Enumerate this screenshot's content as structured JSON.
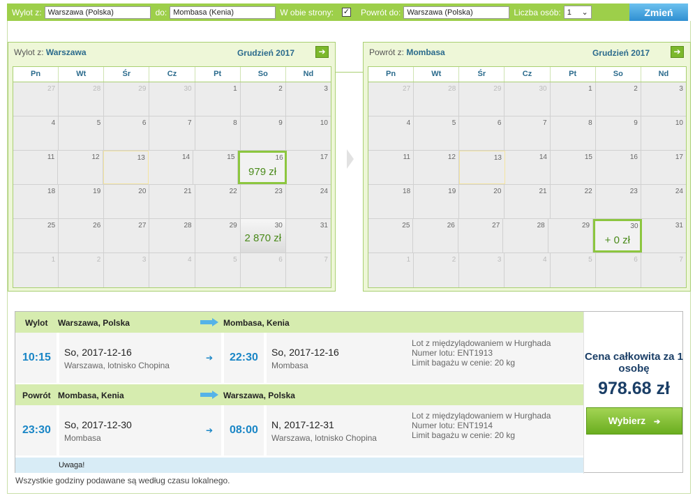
{
  "search": {
    "from_label": "Wylot z:",
    "from_value": "Warszawa (Polska)",
    "to_label": "do:",
    "to_value": "Mombasa (Kenia)",
    "both_ways_label": "W obie strony:",
    "both_ways_check": "✓",
    "return_label": "Powrót do:",
    "return_value": "Warszawa (Polska)",
    "persons_label": "Liczba osób:",
    "persons_value": "1",
    "change_button": "Zmień"
  },
  "calendars": [
    {
      "title_prefix": "Wylot z:",
      "title_city": "Warszawa",
      "month": "Grudzień 2017",
      "days_of_week": [
        "Pn",
        "Wt",
        "Śr",
        "Cz",
        "Pt",
        "So",
        "Nd"
      ],
      "weeks": [
        [
          {
            "d": "27",
            "out": true
          },
          {
            "d": "28",
            "out": true
          },
          {
            "d": "29",
            "out": true
          },
          {
            "d": "30",
            "out": true
          },
          {
            "d": "1"
          },
          {
            "d": "2"
          },
          {
            "d": "3"
          }
        ],
        [
          {
            "d": "4"
          },
          {
            "d": "5"
          },
          {
            "d": "6"
          },
          {
            "d": "7"
          },
          {
            "d": "8"
          },
          {
            "d": "9"
          },
          {
            "d": "10"
          }
        ],
        [
          {
            "d": "11"
          },
          {
            "d": "12"
          },
          {
            "d": "13",
            "hl": true
          },
          {
            "d": "14"
          },
          {
            "d": "15"
          },
          {
            "d": "16",
            "price": "979 zł",
            "sel": true
          },
          {
            "d": "17"
          }
        ],
        [
          {
            "d": "18"
          },
          {
            "d": "19"
          },
          {
            "d": "20"
          },
          {
            "d": "21"
          },
          {
            "d": "22"
          },
          {
            "d": "23"
          },
          {
            "d": "24"
          }
        ],
        [
          {
            "d": "25"
          },
          {
            "d": "26"
          },
          {
            "d": "27"
          },
          {
            "d": "28"
          },
          {
            "d": "29"
          },
          {
            "d": "30",
            "price": "2 870 zł",
            "grad": true
          },
          {
            "d": "31"
          }
        ],
        [
          {
            "d": "1",
            "out": true
          },
          {
            "d": "2",
            "out": true
          },
          {
            "d": "3",
            "out": true
          },
          {
            "d": "4",
            "out": true
          },
          {
            "d": "5",
            "out": true
          },
          {
            "d": "6",
            "out": true
          },
          {
            "d": "7",
            "out": true
          }
        ]
      ]
    },
    {
      "title_prefix": "Powrót z:",
      "title_city": "Mombasa",
      "month": "Grudzień 2017",
      "days_of_week": [
        "Pn",
        "Wt",
        "Śr",
        "Cz",
        "Pt",
        "So",
        "Nd"
      ],
      "weeks": [
        [
          {
            "d": "27",
            "out": true
          },
          {
            "d": "28",
            "out": true
          },
          {
            "d": "29",
            "out": true
          },
          {
            "d": "30",
            "out": true
          },
          {
            "d": "1"
          },
          {
            "d": "2"
          },
          {
            "d": "3"
          }
        ],
        [
          {
            "d": "4"
          },
          {
            "d": "5"
          },
          {
            "d": "6"
          },
          {
            "d": "7"
          },
          {
            "d": "8"
          },
          {
            "d": "9"
          },
          {
            "d": "10"
          }
        ],
        [
          {
            "d": "11"
          },
          {
            "d": "12"
          },
          {
            "d": "13",
            "hl": true
          },
          {
            "d": "14"
          },
          {
            "d": "15"
          },
          {
            "d": "16"
          },
          {
            "d": "17"
          }
        ],
        [
          {
            "d": "18"
          },
          {
            "d": "19"
          },
          {
            "d": "20"
          },
          {
            "d": "21"
          },
          {
            "d": "22"
          },
          {
            "d": "23"
          },
          {
            "d": "24"
          }
        ],
        [
          {
            "d": "25"
          },
          {
            "d": "26"
          },
          {
            "d": "27"
          },
          {
            "d": "28"
          },
          {
            "d": "29"
          },
          {
            "d": "30",
            "price": "+ 0 zł",
            "sel": true
          },
          {
            "d": "31"
          }
        ],
        [
          {
            "d": "1",
            "out": true
          },
          {
            "d": "2",
            "out": true
          },
          {
            "d": "3",
            "out": true
          },
          {
            "d": "4",
            "out": true
          },
          {
            "d": "5",
            "out": true
          },
          {
            "d": "6",
            "out": true
          },
          {
            "d": "7",
            "out": true
          }
        ]
      ]
    }
  ],
  "summary": {
    "outbound": {
      "label": "Wylot",
      "from": "Warszawa, Polska",
      "to": "Mombasa, Kenia",
      "dep_time": "10:15",
      "dep_day": "So,",
      "dep_date": "2017-12-16",
      "dep_place": "Warszawa, lotnisko Chopina",
      "arr_time": "22:30",
      "arr_day": "So,",
      "arr_date": "2017-12-16",
      "arr_place": "Mombasa",
      "info1": "Lot z międzylądowaniem w Hurghada",
      "info2": "Numer lotu: ENT1913",
      "info3": "Limit bagażu w cenie: 20 kg"
    },
    "return": {
      "label": "Powrót",
      "from": "Mombasa, Kenia",
      "to": "Warszawa, Polska",
      "dep_time": "23:30",
      "dep_day": "So,",
      "dep_date": "2017-12-30",
      "dep_place": "Mombasa",
      "arr_time": "08:00",
      "arr_day": "N,",
      "arr_date": "2017-12-31",
      "arr_place": "Warszawa, lotnisko Chopina",
      "info1": "Lot z międzylądowaniem w Hurghada",
      "info2": "Numer lotu: ENT1914",
      "info3": "Limit bagażu w cenie: 20 kg"
    },
    "warning": "Uwaga!",
    "price_caption": "Cena całkowita za 1 osobę",
    "price_value": "978.68 zł",
    "select_button": "Wybierz",
    "select_arrow": "➔",
    "small_arrow": "➔"
  },
  "footer_note": "Wszystkie godziny podawane są według czasu lokalnego.",
  "icons": {
    "next": "➔",
    "dropdown": "⌄"
  },
  "colors": {
    "accent_green": "#9dcf4a",
    "accent_blue": "#1a86c6",
    "price_navy": "#1a3e66"
  }
}
